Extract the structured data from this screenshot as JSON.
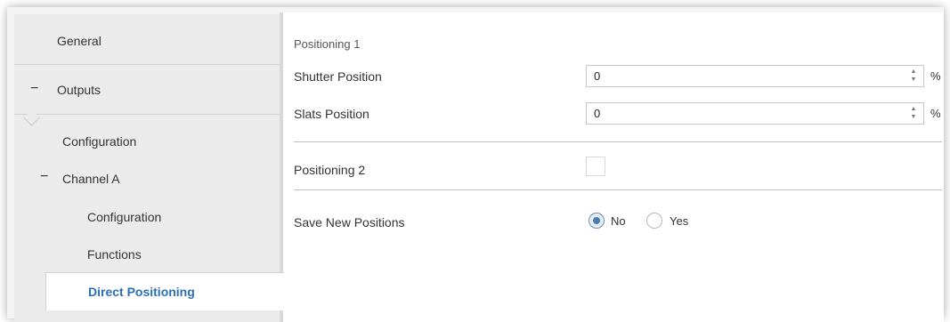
{
  "sidebar": {
    "general": "General",
    "outputs": "Outputs",
    "outputs_collapse": "−",
    "configuration": "Configuration",
    "channel_a": "Channel A",
    "channel_a_collapse": "−",
    "channel_configuration": "Configuration",
    "functions": "Functions",
    "direct_positioning": "Direct Positioning"
  },
  "main": {
    "positioning1_title": "Positioning 1",
    "shutter_label": "Shutter Position",
    "shutter_value": "0",
    "shutter_unit": "%",
    "slats_label": "Slats Position",
    "slats_value": "0",
    "slats_unit": "%",
    "positioning2_label": "Positioning 2",
    "positioning2_checked": false,
    "save_label": "Save New Positions",
    "save_options": [
      "No",
      "Yes"
    ],
    "save_selected": "No"
  },
  "spinner": {
    "up": "▲",
    "down": "▼"
  },
  "colors": {
    "accent": "#2a6fb5",
    "radio_selected": "#4d79b0"
  }
}
